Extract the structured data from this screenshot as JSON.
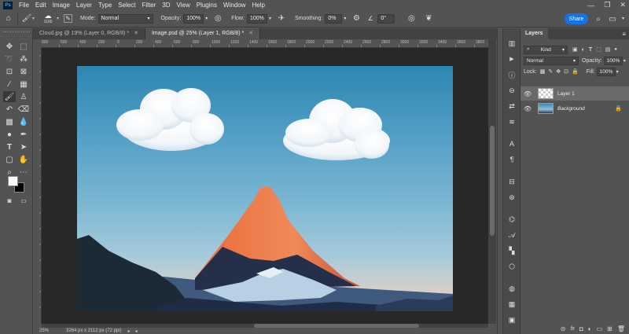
{
  "app": {
    "logo": "Ps"
  },
  "menu": [
    "File",
    "Edit",
    "Image",
    "Layer",
    "Type",
    "Select",
    "Filter",
    "3D",
    "View",
    "Plugins",
    "Window",
    "Help"
  ],
  "window_controls": {
    "minimize": "—",
    "restore": "❐",
    "close": "✕"
  },
  "options_bar": {
    "brush_size": "1100",
    "mode_label": "Mode:",
    "mode_value": "Normal",
    "opacity_label": "Opacity:",
    "opacity_value": "100%",
    "flow_label": "Flow:",
    "flow_value": "100%",
    "smoothing_label": "Smoothing:",
    "smoothing_value": "0%",
    "angle_value": "0°",
    "share_label": "Share"
  },
  "tabs": [
    {
      "label": "Cloud.jpg @ 19% (Layer 0, RGB/8) *",
      "active": false
    },
    {
      "label": "Image.psd @ 25% (Layer 1, RGB/8) *",
      "active": true
    }
  ],
  "ruler_marks": [
    "800",
    "600",
    "400",
    "200",
    "0",
    "200",
    "400",
    "600",
    "800",
    "1000",
    "1200",
    "1400",
    "1600",
    "1800",
    "2000",
    "2200",
    "2400",
    "2600",
    "2800",
    "3000",
    "3200",
    "3400",
    "3600",
    "3800",
    "4000"
  ],
  "status": {
    "zoom": "25%",
    "doc_info": "3264 px x 2112 px (72 ppi)"
  },
  "layers_panel": {
    "tab_label": "Layers",
    "filter_kind": "Kind",
    "blend_mode": "Normal",
    "opacity_label": "Opacity:",
    "opacity_value": "100%",
    "lock_label": "Lock:",
    "fill_label": "Fill:",
    "fill_value": "100%",
    "layers": [
      {
        "name": "Layer 1",
        "selected": true
      },
      {
        "name": "Background",
        "selected": false,
        "locked": true
      }
    ],
    "footer_icons": [
      "link-icon",
      "fx-icon",
      "mask-icon",
      "adjustment-icon",
      "group-icon",
      "new-layer-icon",
      "delete-icon"
    ],
    "footer_glyphs": [
      "⊝",
      "fx",
      "◘",
      "◐",
      "▭",
      "⊞",
      "🗑"
    ]
  },
  "colors": {
    "accent": "#1473e6",
    "panel": "#535353",
    "workarea": "#282828"
  }
}
